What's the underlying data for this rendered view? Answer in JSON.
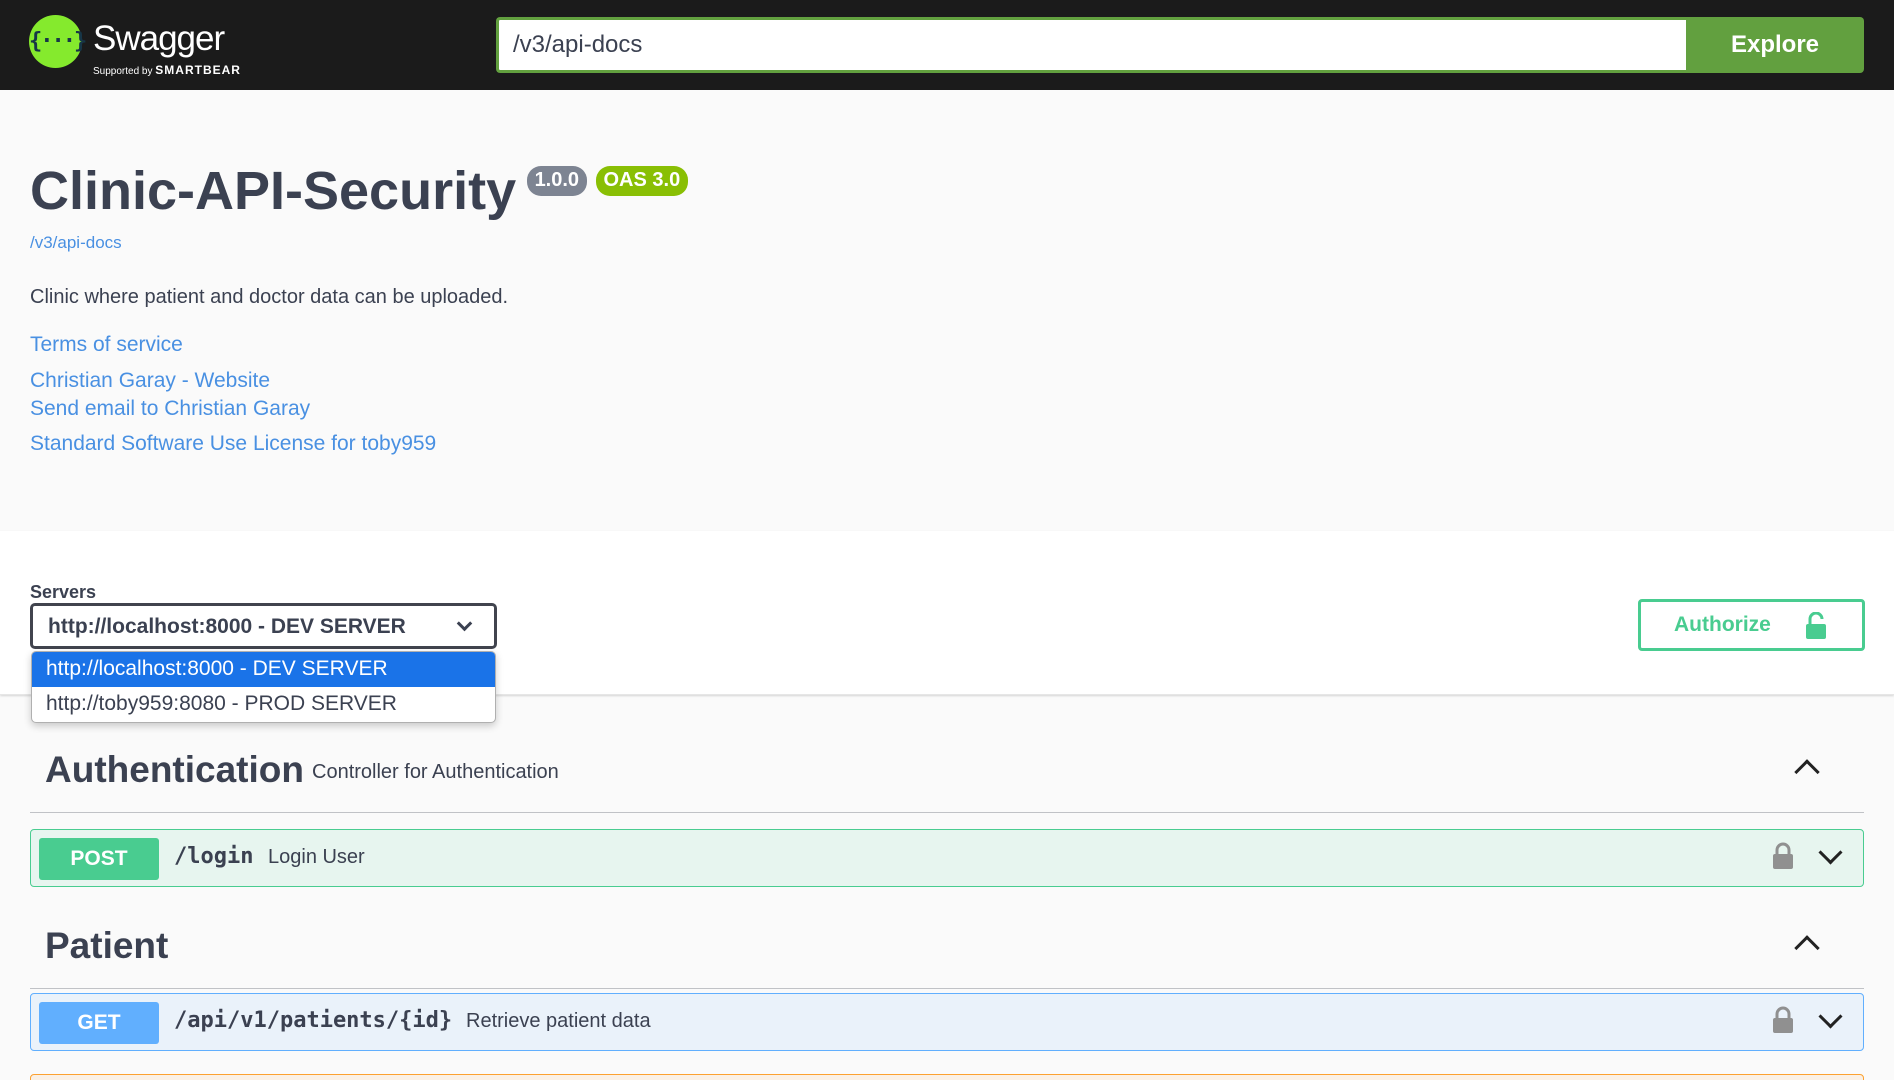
{
  "topbar": {
    "logo_name": "Swagger",
    "logo_sub_prefix": "Supported by",
    "logo_sub_brand": "SMARTBEAR",
    "url_value": "/v3/api-docs",
    "explore_label": "Explore"
  },
  "info": {
    "title": "Clinic-API-Security",
    "version": "1.0.0",
    "oas": "OAS 3.0",
    "spec_link": "/v3/api-docs",
    "description": "Clinic where patient and doctor data can be uploaded.",
    "links": {
      "terms": "Terms of service",
      "website": "Christian Garay - Website",
      "email": "Send email to Christian Garay",
      "license": "Standard Software Use License for toby959"
    }
  },
  "servers": {
    "label": "Servers",
    "selected": "http://localhost:8000 - DEV SERVER",
    "options": [
      "http://localhost:8000 - DEV SERVER",
      "http://toby959:8080 - PROD SERVER"
    ]
  },
  "authorize": {
    "label": "Authorize"
  },
  "sections": [
    {
      "name": "Authentication",
      "description": "Controller for Authentication",
      "operations": [
        {
          "method": "POST",
          "path": "/login",
          "summary": "Login User"
        }
      ]
    },
    {
      "name": "Patient",
      "description": "",
      "operations": [
        {
          "method": "GET",
          "path": "/api/v1/patients/{id}",
          "summary": "Retrieve patient data"
        }
      ]
    }
  ],
  "colors": {
    "topbar": "#1b1b1b",
    "explore": "#62a03f",
    "post": "#49cc90",
    "get": "#61affe",
    "link": "#4990e2",
    "version_badge": "#7d8492",
    "oas_badge": "#89bf04"
  },
  "icons": [
    "swagger-logo-icon",
    "chevron-down-icon",
    "unlock-icon",
    "lock-icon",
    "chevron-up-icon"
  ]
}
